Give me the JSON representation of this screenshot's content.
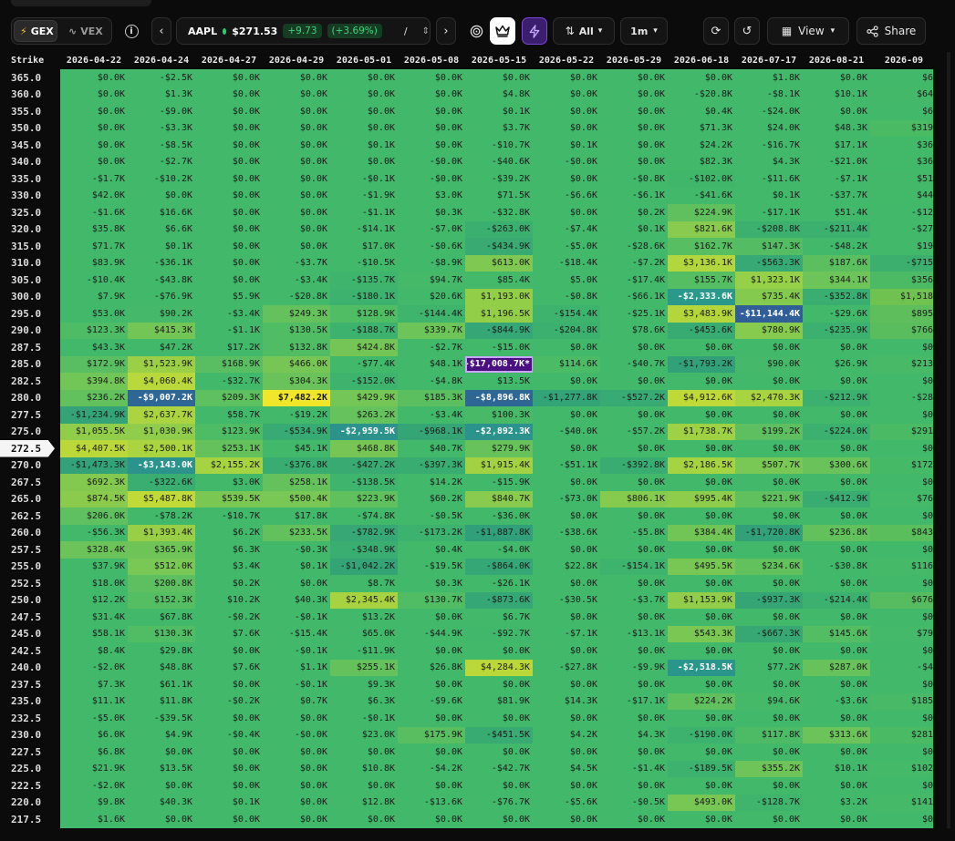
{
  "toolbar": {
    "mode_options": [
      {
        "label": "GEX",
        "icon": "lightning-icon",
        "active": true
      },
      {
        "label": "VEX",
        "icon": "wave-icon",
        "active": false
      }
    ],
    "info_icon": "info-icon",
    "prev_icon": "chevron-left-icon",
    "next_icon": "chevron-right-icon",
    "ticker": {
      "symbol": "AAPL",
      "price": "$271.53",
      "change": "+9.73",
      "change_pct": "(+3.69%)",
      "separator": "/"
    },
    "target_icon": "target-icon",
    "crown_icon": "crown-icon",
    "bolt_icon": "bolt-icon",
    "sort_label": "All",
    "interval_label": "1m",
    "refresh_icon": "refresh-icon",
    "history_icon": "history-icon",
    "view_label": "View",
    "share_label": "Share"
  },
  "grid": {
    "strike_header": "Strike",
    "current_strike": "272.5",
    "dates": [
      "2026-04-22",
      "2026-04-24",
      "2026-04-27",
      "2026-04-29",
      "2026-05-01",
      "2026-05-08",
      "2026-05-15",
      "2026-05-22",
      "2026-05-29",
      "2026-06-18",
      "2026-07-17",
      "2026-08-21",
      "2026-09"
    ],
    "rows": [
      {
        "strike": "365.0",
        "values": [
          "$0.0K",
          "-$2.5K",
          "$0.0K",
          "$0.0K",
          "$0.0K",
          "$0.0K",
          "$0.0K",
          "$0.0K",
          "$0.0K",
          "$0.0K",
          "$1.8K",
          "$0.0K",
          "$6"
        ]
      },
      {
        "strike": "360.0",
        "values": [
          "$0.0K",
          "$1.3K",
          "$0.0K",
          "$0.0K",
          "$0.0K",
          "$0.0K",
          "$4.8K",
          "$0.0K",
          "$0.0K",
          "-$20.8K",
          "-$8.1K",
          "$10.1K",
          "$64"
        ]
      },
      {
        "strike": "355.0",
        "values": [
          "$0.0K",
          "-$9.0K",
          "$0.0K",
          "$0.0K",
          "$0.0K",
          "$0.0K",
          "$0.1K",
          "$0.0K",
          "$0.0K",
          "$0.4K",
          "-$24.0K",
          "$0.0K",
          "$6"
        ]
      },
      {
        "strike": "350.0",
        "values": [
          "$0.0K",
          "-$3.3K",
          "$0.0K",
          "$0.0K",
          "$0.0K",
          "$0.0K",
          "$3.7K",
          "$0.0K",
          "$0.0K",
          "$71.3K",
          "$24.0K",
          "$48.3K",
          "$319"
        ]
      },
      {
        "strike": "345.0",
        "values": [
          "$0.0K",
          "-$8.5K",
          "$0.0K",
          "$0.0K",
          "$0.1K",
          "$0.0K",
          "-$10.7K",
          "$0.1K",
          "$0.0K",
          "$24.2K",
          "-$16.7K",
          "$17.1K",
          "$36"
        ]
      },
      {
        "strike": "340.0",
        "values": [
          "$0.0K",
          "-$2.7K",
          "$0.0K",
          "$0.0K",
          "$0.0K",
          "-$0.0K",
          "-$40.6K",
          "-$0.0K",
          "$0.0K",
          "$82.3K",
          "$4.3K",
          "-$21.0K",
          "$36"
        ]
      },
      {
        "strike": "335.0",
        "values": [
          "-$1.7K",
          "-$10.2K",
          "$0.0K",
          "$0.0K",
          "-$0.1K",
          "-$0.0K",
          "-$39.2K",
          "$0.0K",
          "-$0.8K",
          "-$102.0K",
          "-$11.6K",
          "-$7.1K",
          "$51"
        ]
      },
      {
        "strike": "330.0",
        "values": [
          "$42.0K",
          "$0.0K",
          "$0.0K",
          "$0.0K",
          "-$1.9K",
          "$3.0K",
          "$71.5K",
          "-$6.6K",
          "-$6.1K",
          "-$41.6K",
          "$0.1K",
          "-$37.7K",
          "$44"
        ]
      },
      {
        "strike": "325.0",
        "values": [
          "-$1.6K",
          "$16.6K",
          "$0.0K",
          "$0.0K",
          "-$1.1K",
          "$0.3K",
          "-$32.8K",
          "$0.0K",
          "$0.2K",
          "$224.9K",
          "-$17.1K",
          "$51.4K",
          "-$12"
        ]
      },
      {
        "strike": "320.0",
        "values": [
          "$35.8K",
          "$6.6K",
          "$0.0K",
          "$0.0K",
          "-$14.1K",
          "-$7.0K",
          "-$263.0K",
          "-$7.4K",
          "$0.1K",
          "$821.6K",
          "-$208.8K",
          "-$211.4K",
          "-$27"
        ]
      },
      {
        "strike": "315.0",
        "values": [
          "$71.7K",
          "$0.1K",
          "$0.0K",
          "$0.0K",
          "$17.0K",
          "-$0.6K",
          "-$434.9K",
          "-$5.0K",
          "-$28.6K",
          "$162.7K",
          "$147.3K",
          "-$48.2K",
          "$19"
        ]
      },
      {
        "strike": "310.0",
        "values": [
          "$83.9K",
          "-$36.1K",
          "$0.0K",
          "-$3.7K",
          "-$10.5K",
          "-$8.9K",
          "$613.0K",
          "-$18.4K",
          "-$7.2K",
          "$3,136.1K",
          "-$563.3K",
          "$187.6K",
          "-$715"
        ]
      },
      {
        "strike": "305.0",
        "values": [
          "-$10.4K",
          "-$43.8K",
          "$0.0K",
          "-$3.4K",
          "-$135.7K",
          "$94.7K",
          "$85.4K",
          "$5.0K",
          "-$17.4K",
          "$155.7K",
          "$1,323.1K",
          "$344.1K",
          "$356"
        ]
      },
      {
        "strike": "300.0",
        "values": [
          "$7.9K",
          "-$76.9K",
          "$5.9K",
          "-$20.8K",
          "-$180.1K",
          "$20.6K",
          "$1,193.0K",
          "-$0.8K",
          "-$66.1K",
          "-$2,333.6K",
          "$735.4K",
          "-$352.8K",
          "$1,518"
        ]
      },
      {
        "strike": "295.0",
        "values": [
          "$53.0K",
          "$90.2K",
          "-$3.4K",
          "$249.3K",
          "$128.9K",
          "-$144.4K",
          "$1,196.5K",
          "-$154.4K",
          "-$25.1K",
          "$3,483.9K",
          "-$11,144.4K",
          "-$29.6K",
          "$895"
        ]
      },
      {
        "strike": "290.0",
        "values": [
          "$123.3K",
          "$415.3K",
          "-$1.1K",
          "$130.5K",
          "-$188.7K",
          "$339.7K",
          "-$844.9K",
          "-$204.8K",
          "$78.6K",
          "-$453.6K",
          "$780.9K",
          "-$235.9K",
          "$766"
        ]
      },
      {
        "strike": "287.5",
        "values": [
          "$43.3K",
          "$47.2K",
          "$17.2K",
          "$132.8K",
          "$424.8K",
          "-$2.7K",
          "-$15.0K",
          "$0.0K",
          "$0.0K",
          "$0.0K",
          "$0.0K",
          "$0.0K",
          "$0"
        ]
      },
      {
        "strike": "285.0",
        "values": [
          "$172.9K",
          "$1,523.9K",
          "$168.9K",
          "$466.0K",
          "-$77.4K",
          "$48.1K",
          "-$17,008.7K*",
          "$114.6K",
          "-$40.7K",
          "-$1,793.2K",
          "$90.0K",
          "$26.9K",
          "$213"
        ]
      },
      {
        "strike": "282.5",
        "values": [
          "$394.8K",
          "$4,060.4K",
          "-$32.7K",
          "$304.3K",
          "-$152.0K",
          "-$4.8K",
          "$13.5K",
          "$0.0K",
          "$0.0K",
          "$0.0K",
          "$0.0K",
          "$0.0K",
          "$0"
        ]
      },
      {
        "strike": "280.0",
        "values": [
          "$236.2K",
          "-$9,007.2K",
          "$209.3K",
          "$7,482.2K",
          "$429.9K",
          "$185.3K",
          "-$8,896.8K",
          "-$1,277.8K",
          "-$527.2K",
          "$4,912.6K",
          "$2,470.3K",
          "-$212.9K",
          "-$28"
        ]
      },
      {
        "strike": "277.5",
        "values": [
          "-$1,234.9K",
          "$2,637.7K",
          "$58.7K",
          "-$19.2K",
          "$263.2K",
          "-$3.4K",
          "$100.3K",
          "$0.0K",
          "$0.0K",
          "$0.0K",
          "$0.0K",
          "$0.0K",
          "$0"
        ]
      },
      {
        "strike": "275.0",
        "values": [
          "$1,055.5K",
          "$1,030.9K",
          "$123.9K",
          "-$534.9K",
          "-$2,959.5K",
          "-$968.1K",
          "-$2,892.3K",
          "-$40.0K",
          "-$57.2K",
          "$1,738.7K",
          "$199.2K",
          "-$224.0K",
          "$291"
        ]
      },
      {
        "strike": "272.5",
        "values": [
          "$4,407.5K",
          "$2,500.1K",
          "$253.1K",
          "$45.1K",
          "$468.8K",
          "$40.7K",
          "$279.9K",
          "$0.0K",
          "$0.0K",
          "$0.0K",
          "$0.0K",
          "$0.0K",
          "$0"
        ]
      },
      {
        "strike": "270.0",
        "values": [
          "-$1,473.3K",
          "-$3,143.0K",
          "$2,155.2K",
          "-$376.8K",
          "-$427.2K",
          "-$397.3K",
          "$1,915.4K",
          "-$51.1K",
          "-$392.8K",
          "$2,186.5K",
          "$507.7K",
          "$300.6K",
          "$172"
        ]
      },
      {
        "strike": "267.5",
        "values": [
          "$692.3K",
          "-$322.6K",
          "$3.0K",
          "$258.1K",
          "-$138.5K",
          "$14.2K",
          "-$15.9K",
          "$0.0K",
          "$0.0K",
          "$0.0K",
          "$0.0K",
          "$0.0K",
          "$0"
        ]
      },
      {
        "strike": "265.0",
        "values": [
          "$874.5K",
          "$5,487.8K",
          "$539.5K",
          "$500.4K",
          "$223.9K",
          "$60.2K",
          "$840.7K",
          "-$73.0K",
          "$806.1K",
          "$995.4K",
          "$221.9K",
          "-$412.9K",
          "$76"
        ]
      },
      {
        "strike": "262.5",
        "values": [
          "$206.0K",
          "-$78.2K",
          "-$10.7K",
          "$17.8K",
          "-$74.8K",
          "-$0.5K",
          "-$36.0K",
          "$0.0K",
          "$0.0K",
          "$0.0K",
          "$0.0K",
          "$0.0K",
          "$0"
        ]
      },
      {
        "strike": "260.0",
        "values": [
          "-$56.3K",
          "$1,393.4K",
          "$6.2K",
          "$233.5K",
          "-$782.9K",
          "-$173.2K",
          "-$1,887.8K",
          "-$38.6K",
          "-$5.8K",
          "$384.4K",
          "-$1,720.8K",
          "$236.8K",
          "$843"
        ]
      },
      {
        "strike": "257.5",
        "values": [
          "$328.4K",
          "$365.9K",
          "$6.3K",
          "-$0.3K",
          "-$348.9K",
          "$0.4K",
          "-$4.0K",
          "$0.0K",
          "$0.0K",
          "$0.0K",
          "$0.0K",
          "$0.0K",
          "$0"
        ]
      },
      {
        "strike": "255.0",
        "values": [
          "$37.9K",
          "$512.0K",
          "$3.4K",
          "$0.1K",
          "-$1,042.2K",
          "-$19.5K",
          "-$864.0K",
          "$22.8K",
          "-$154.1K",
          "$495.5K",
          "$234.6K",
          "-$30.8K",
          "$116"
        ]
      },
      {
        "strike": "252.5",
        "values": [
          "$18.0K",
          "$200.8K",
          "$0.2K",
          "$0.0K",
          "$8.7K",
          "$0.3K",
          "-$26.1K",
          "$0.0K",
          "$0.0K",
          "$0.0K",
          "$0.0K",
          "$0.0K",
          "$0"
        ]
      },
      {
        "strike": "250.0",
        "values": [
          "$12.2K",
          "$152.3K",
          "$10.2K",
          "$40.3K",
          "$2,345.4K",
          "$130.7K",
          "-$873.6K",
          "-$30.5K",
          "-$3.7K",
          "$1,153.9K",
          "-$937.3K",
          "-$214.4K",
          "$676"
        ]
      },
      {
        "strike": "247.5",
        "values": [
          "$31.4K",
          "$67.8K",
          "-$0.2K",
          "-$0.1K",
          "$13.2K",
          "$0.0K",
          "$6.7K",
          "$0.0K",
          "$0.0K",
          "$0.0K",
          "$0.0K",
          "$0.0K",
          "$0"
        ]
      },
      {
        "strike": "245.0",
        "values": [
          "$58.1K",
          "$130.3K",
          "$7.6K",
          "-$15.4K",
          "$65.0K",
          "-$44.9K",
          "-$92.7K",
          "-$7.1K",
          "-$13.1K",
          "$543.3K",
          "-$667.3K",
          "$145.6K",
          "$79"
        ]
      },
      {
        "strike": "242.5",
        "values": [
          "$8.4K",
          "$29.8K",
          "$0.0K",
          "-$0.1K",
          "-$11.9K",
          "$0.0K",
          "$0.0K",
          "$0.0K",
          "$0.0K",
          "$0.0K",
          "$0.0K",
          "$0.0K",
          "$0"
        ]
      },
      {
        "strike": "240.0",
        "values": [
          "-$2.0K",
          "$48.8K",
          "$7.6K",
          "$1.1K",
          "$255.1K",
          "$26.8K",
          "$4,284.3K",
          "-$27.8K",
          "-$9.9K",
          "-$2,518.5K",
          "$77.2K",
          "$287.0K",
          "-$4"
        ]
      },
      {
        "strike": "237.5",
        "values": [
          "$7.3K",
          "$61.1K",
          "$0.0K",
          "-$0.1K",
          "$9.3K",
          "$0.0K",
          "$0.0K",
          "$0.0K",
          "$0.0K",
          "$0.0K",
          "$0.0K",
          "$0.0K",
          "$0"
        ]
      },
      {
        "strike": "235.0",
        "values": [
          "$11.1K",
          "$11.8K",
          "-$0.2K",
          "$0.7K",
          "$6.3K",
          "-$9.6K",
          "$81.9K",
          "$14.3K",
          "-$17.1K",
          "$224.2K",
          "$94.6K",
          "-$3.6K",
          "$185"
        ]
      },
      {
        "strike": "232.5",
        "values": [
          "-$5.0K",
          "-$39.5K",
          "$0.0K",
          "$0.0K",
          "-$0.1K",
          "$0.0K",
          "$0.0K",
          "$0.0K",
          "$0.0K",
          "$0.0K",
          "$0.0K",
          "$0.0K",
          "$0"
        ]
      },
      {
        "strike": "230.0",
        "values": [
          "$6.0K",
          "$4.9K",
          "-$0.4K",
          "-$0.0K",
          "$23.0K",
          "$175.9K",
          "-$451.5K",
          "$4.2K",
          "$4.3K",
          "-$190.0K",
          "$117.8K",
          "$313.6K",
          "$281"
        ]
      },
      {
        "strike": "227.5",
        "values": [
          "$6.8K",
          "$0.0K",
          "$0.0K",
          "$0.0K",
          "$0.0K",
          "$0.0K",
          "$0.0K",
          "$0.0K",
          "$0.0K",
          "$0.0K",
          "$0.0K",
          "$0.0K",
          "$0"
        ]
      },
      {
        "strike": "225.0",
        "values": [
          "$21.9K",
          "$13.5K",
          "$0.0K",
          "$0.0K",
          "$10.8K",
          "-$4.2K",
          "-$42.7K",
          "$4.5K",
          "-$1.4K",
          "-$189.5K",
          "$355.2K",
          "$10.1K",
          "$102"
        ]
      },
      {
        "strike": "222.5",
        "values": [
          "-$2.0K",
          "$0.0K",
          "$0.0K",
          "$0.0K",
          "$0.0K",
          "$0.0K",
          "$0.0K",
          "$0.0K",
          "$0.0K",
          "$0.0K",
          "$0.0K",
          "$0.0K",
          "$0"
        ]
      },
      {
        "strike": "220.0",
        "values": [
          "$9.8K",
          "$40.3K",
          "$0.1K",
          "$0.0K",
          "$12.8K",
          "-$13.6K",
          "-$76.7K",
          "-$5.6K",
          "-$0.5K",
          "$493.0K",
          "-$128.7K",
          "$3.2K",
          "$141"
        ]
      },
      {
        "strike": "217.5",
        "values": [
          "$1.6K",
          "$0.0K",
          "$0.0K",
          "$0.0K",
          "$0.0K",
          "$0.0K",
          "$0.0K",
          "$0.0K",
          "$0.0K",
          "$0.0K",
          "$0.0K",
          "$0.0K",
          "$0"
        ]
      }
    ]
  },
  "colors": {
    "base_green": "#41b86a",
    "highlight_yellow": "#f0e62a",
    "strong_blue": "#2f5f96",
    "extreme_purple": "#4a1080"
  }
}
